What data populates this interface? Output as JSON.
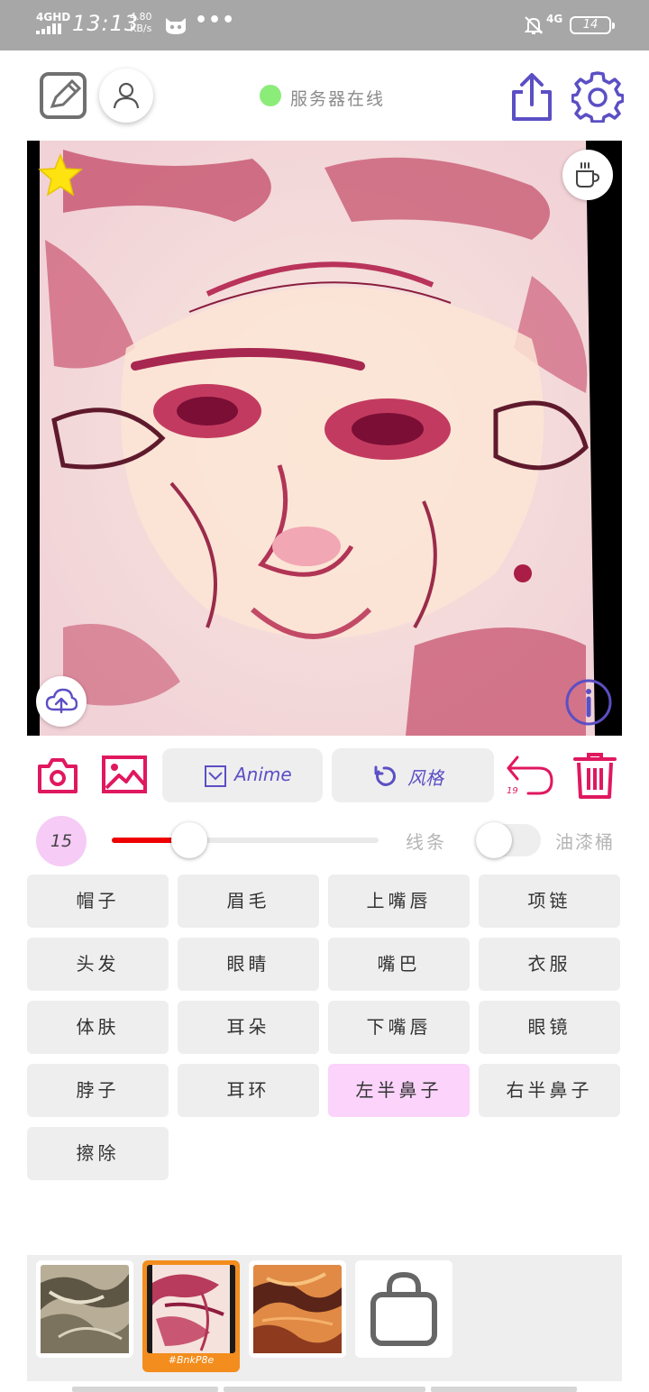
{
  "status_bar": {
    "network": "4GHD",
    "time": "13:13",
    "speed_value": "4.80",
    "speed_unit": "KB/s",
    "more": "•••",
    "signal_right": "4G",
    "battery": "14"
  },
  "toolbar": {
    "server_status": "服务器在线",
    "server_color": "#8cec79",
    "accent_color": "#5b4fc4",
    "alert_color": "#e0185f"
  },
  "actions": {
    "model_label": "Anime",
    "style_label": "风格",
    "undo_count": "19"
  },
  "brush": {
    "size": "15",
    "slider_fraction": 0.29,
    "line_label": "线条",
    "bucket_label": "油漆桶",
    "bucket_enabled": false
  },
  "parts": [
    {
      "label": "帽子",
      "active": false
    },
    {
      "label": "眉毛",
      "active": false
    },
    {
      "label": "上嘴唇",
      "active": false
    },
    {
      "label": "项链",
      "active": false
    },
    {
      "label": "头发",
      "active": false
    },
    {
      "label": "眼睛",
      "active": false
    },
    {
      "label": "嘴巴",
      "active": false
    },
    {
      "label": "衣服",
      "active": false
    },
    {
      "label": "体肤",
      "active": false
    },
    {
      "label": "耳朵",
      "active": false
    },
    {
      "label": "下嘴唇",
      "active": false
    },
    {
      "label": "眼镜",
      "active": false
    },
    {
      "label": "脖子",
      "active": false
    },
    {
      "label": "耳环",
      "active": false
    },
    {
      "label": "左半鼻子",
      "active": true
    },
    {
      "label": "右半鼻子",
      "active": false
    },
    {
      "label": "擦除",
      "active": false
    }
  ],
  "styles": [
    {
      "name": "style-1",
      "active": false
    },
    {
      "name": "style-2",
      "active": true,
      "code": "#BnkP8e"
    },
    {
      "name": "style-3",
      "active": false
    }
  ]
}
